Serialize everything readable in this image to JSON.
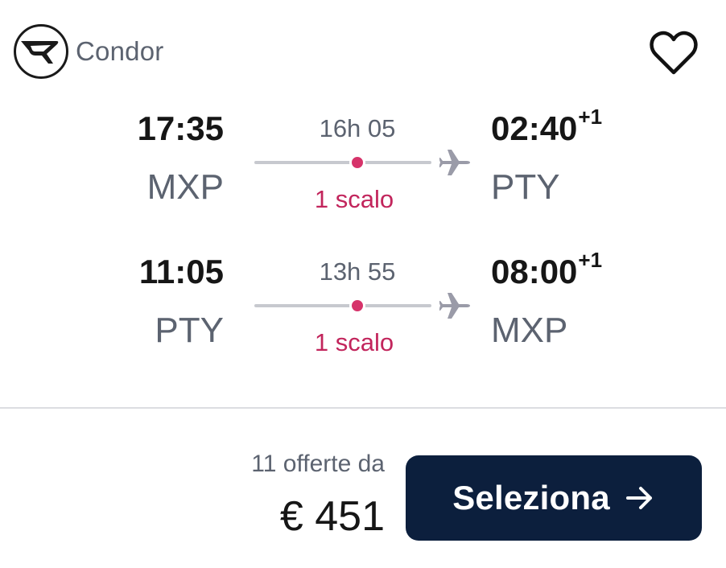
{
  "airline": {
    "name": "Condor",
    "logo_icon": "condor-logo-icon"
  },
  "favorite": {
    "icon": "heart-icon"
  },
  "legs": [
    {
      "departure_time": "17:35",
      "departure_code": "MXP",
      "duration": "16h 05",
      "stops": "1 scalo",
      "arrival_time": "02:40",
      "arrival_day_offset": "+1",
      "arrival_code": "PTY"
    },
    {
      "departure_time": "11:05",
      "departure_code": "PTY",
      "duration": "13h 55",
      "stops": "1 scalo",
      "arrival_time": "08:00",
      "arrival_day_offset": "+1",
      "arrival_code": "MXP"
    }
  ],
  "footer": {
    "offers_text": "11 offerte da",
    "price": "€ 451",
    "button_label": "Seleziona",
    "button_icon": "arrow-right-icon"
  },
  "colors": {
    "stop_accent": "#d6336a",
    "button_bg": "#0c1f3d",
    "muted_text": "#5c6370"
  }
}
